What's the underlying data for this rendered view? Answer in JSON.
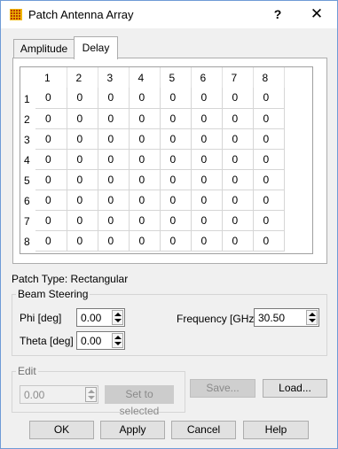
{
  "window": {
    "title": "Patch Antenna Array",
    "help": "?",
    "close": "✕"
  },
  "tabs": [
    {
      "label": "Amplitude"
    },
    {
      "label": "Delay"
    }
  ],
  "grid": {
    "columns": [
      "1",
      "2",
      "3",
      "4",
      "5",
      "6",
      "7",
      "8"
    ],
    "rows": [
      {
        "label": "1",
        "values": [
          "0",
          "0",
          "0",
          "0",
          "0",
          "0",
          "0",
          "0"
        ]
      },
      {
        "label": "2",
        "values": [
          "0",
          "0",
          "0",
          "0",
          "0",
          "0",
          "0",
          "0"
        ]
      },
      {
        "label": "3",
        "values": [
          "0",
          "0",
          "0",
          "0",
          "0",
          "0",
          "0",
          "0"
        ]
      },
      {
        "label": "4",
        "values": [
          "0",
          "0",
          "0",
          "0",
          "0",
          "0",
          "0",
          "0"
        ]
      },
      {
        "label": "5",
        "values": [
          "0",
          "0",
          "0",
          "0",
          "0",
          "0",
          "0",
          "0"
        ]
      },
      {
        "label": "6",
        "values": [
          "0",
          "0",
          "0",
          "0",
          "0",
          "0",
          "0",
          "0"
        ]
      },
      {
        "label": "7",
        "values": [
          "0",
          "0",
          "0",
          "0",
          "0",
          "0",
          "0",
          "0"
        ]
      },
      {
        "label": "8",
        "values": [
          "0",
          "0",
          "0",
          "0",
          "0",
          "0",
          "0",
          "0"
        ]
      }
    ]
  },
  "patch_type": "Patch Type: Rectangular",
  "beam_steering": {
    "title": "Beam Steering",
    "phi_label": "Phi [deg]",
    "phi_value": "0.00",
    "theta_label": "Theta [deg]",
    "theta_value": "0.00",
    "frequency_label": "Frequency [GHz]",
    "frequency_value": "30.50"
  },
  "edit": {
    "title": "Edit",
    "value": "0.00",
    "set_label": "Set to selected"
  },
  "buttons": {
    "save": "Save...",
    "load": "Load...",
    "ok": "OK",
    "apply": "Apply",
    "cancel": "Cancel",
    "help": "Help"
  },
  "colors": {
    "icon": "#f0b400",
    "window_border": "#6f9bd6"
  }
}
